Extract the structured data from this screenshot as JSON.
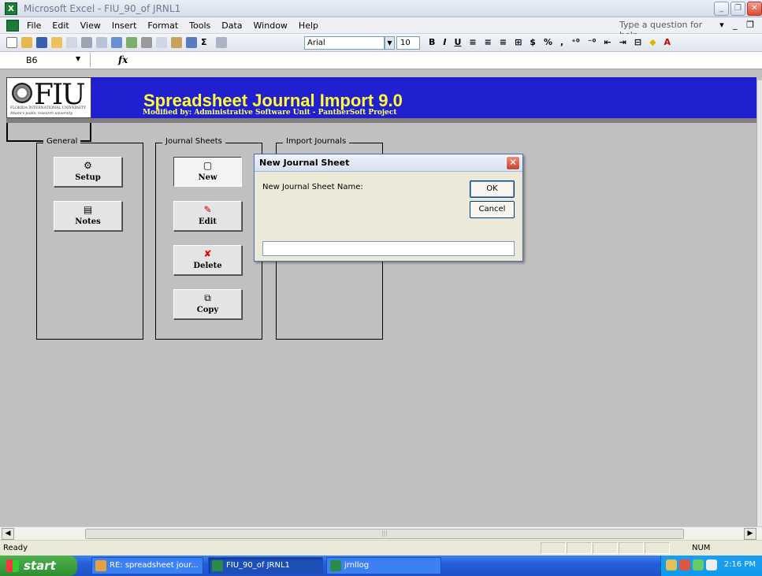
{
  "window": {
    "title": "Microsoft Excel - FIU_90_of JRNL1",
    "app_icon": "X"
  },
  "menu": {
    "items": [
      "File",
      "Edit",
      "View",
      "Insert",
      "Format",
      "Tools",
      "Data",
      "Window",
      "Help"
    ],
    "help_placeholder": "Type a question for help"
  },
  "toolbar": {
    "font": "Arial",
    "size": "10",
    "bold": "B",
    "italic": "I",
    "underline": "U",
    "currency": "$",
    "percent": "%",
    "comma": ","
  },
  "formula_bar": {
    "cell_ref": "B6",
    "fx": "fx"
  },
  "banner": {
    "logo_text": "FIU",
    "logo_sub1": "FLORIDA INTERNATIONAL UNIVERSITY",
    "logo_sub2": "Miami's public research university",
    "title": "Spreadsheet Journal Import 9.0",
    "subtitle": "Modified by: Administrative Software Unit - PantherSoft Project",
    "accent": "#2020d0",
    "title_color": "#ffff33"
  },
  "groups": {
    "general": {
      "legend": "General",
      "buttons": [
        {
          "label": "Setup",
          "icon": "setup-icon",
          "glyph": "⚙"
        },
        {
          "label": "Notes",
          "icon": "notes-icon",
          "glyph": "▤"
        }
      ]
    },
    "journal_sheets": {
      "legend": "Journal Sheets",
      "buttons": [
        {
          "label": "New",
          "icon": "new-document-icon",
          "glyph": "▢"
        },
        {
          "label": "Edit",
          "icon": "pencil-icon",
          "glyph": "✎"
        },
        {
          "label": "Delete",
          "icon": "delete-icon",
          "glyph": "✘"
        },
        {
          "label": "Copy",
          "icon": "copy-icon",
          "glyph": "⧉"
        }
      ]
    },
    "import_journals": {
      "legend": "Import Journals"
    }
  },
  "dialog": {
    "title": "New Journal Sheet",
    "prompt": "New Journal Sheet Name:",
    "ok": "OK",
    "cancel": "Cancel",
    "input_value": ""
  },
  "status": {
    "left": "Ready",
    "num": "NUM"
  },
  "taskbar": {
    "start": "start",
    "tasks": [
      "RE: spreadsheet jour...",
      "FIU_90_of JRNL1",
      "jrnllog"
    ],
    "clock": "2:16 PM"
  }
}
